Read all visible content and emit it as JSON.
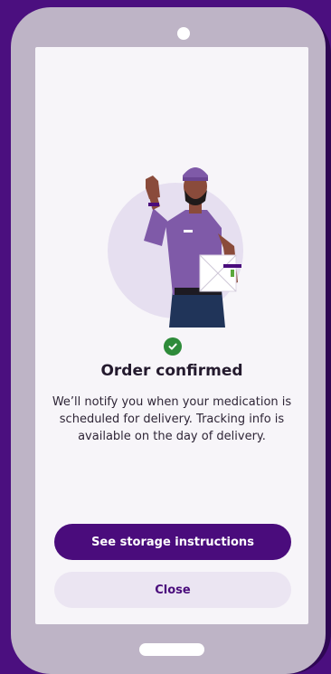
{
  "confirmation": {
    "title": "Order confirmed",
    "message": "We’ll notify you when your medication is scheduled for delivery. Tracking info is available on the day of delivery.",
    "status_icon": "check-icon",
    "illustration": "delivery-person-waving-with-package"
  },
  "actions": {
    "primary_label": "See storage instructions",
    "secondary_label": "Close"
  },
  "colors": {
    "brand": "#4a0c7c",
    "background": "#4b0f7f",
    "success": "#2e8b3a",
    "secondary_button_bg": "#ebe5f2"
  }
}
